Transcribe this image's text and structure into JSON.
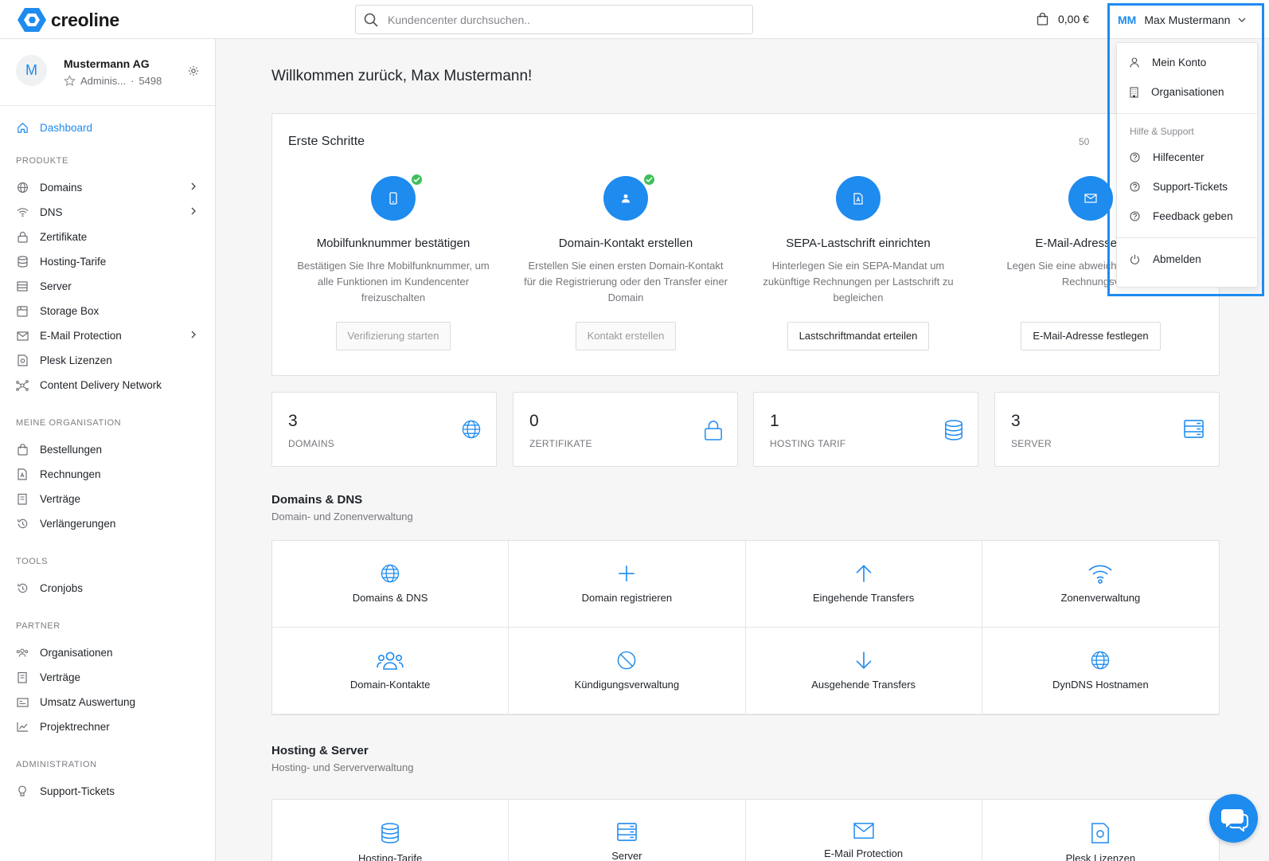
{
  "brand": {
    "name": "creoline",
    "color": "#1e8bef"
  },
  "search": {
    "placeholder": "Kundencenter durchsuchen.."
  },
  "cart": {
    "amount": "0,00 €"
  },
  "user": {
    "initials": "MM",
    "name": "Max Mustermann"
  },
  "org": {
    "avatar": "M",
    "name": "Mustermann AG",
    "role": "Adminis...",
    "separator": "·",
    "number": "5498"
  },
  "sidebar": {
    "dashboard": "Dashboard",
    "sections": [
      {
        "title": "PRODUKTE",
        "items": [
          "Domains",
          "DNS",
          "Zertifikate",
          "Hosting-Tarife",
          "Server",
          "Storage Box",
          "E-Mail Protection",
          "Plesk Lizenzen",
          "Content Delivery Network"
        ]
      },
      {
        "title": "MEINE ORGANISATION",
        "items": [
          "Bestellungen",
          "Rechnungen",
          "Verträge",
          "Verlängerungen"
        ]
      },
      {
        "title": "TOOLS",
        "items": [
          "Cronjobs"
        ]
      },
      {
        "title": "PARTNER",
        "items": [
          "Organisationen",
          "Verträge",
          "Umsatz Auswertung",
          "Projektrechner"
        ]
      },
      {
        "title": "ADMINISTRATION",
        "items": [
          "Support-Tickets"
        ]
      }
    ]
  },
  "main": {
    "welcome": "Willkommen zurück, Max Mustermann!",
    "steps": {
      "title": "Erste Schritte",
      "progress": "50",
      "items": [
        {
          "title": "Mobilfunknummer bestätigen",
          "desc": "Bestätigen Sie Ihre Mobilfunknummer, um alle Funktionen im Kundencenter freizuschalten",
          "button": "Verifizierung starten",
          "done": true,
          "icon": "phone-icon"
        },
        {
          "title": "Domain-Kontakt erstellen",
          "desc": "Erstellen Sie einen ersten Domain-Kontakt für die Registrierung oder den Transfer einer Domain",
          "button": "Kontakt erstellen",
          "done": true,
          "icon": "user-icon"
        },
        {
          "title": "SEPA-Lastschrift einrichten",
          "desc": "Hinterlegen Sie ein SEPA-Mandat um zukünftige Rechnungen per Lastschrift zu begleichen",
          "button": "Lastschriftmandat erteilen",
          "done": false,
          "icon": "pdf-icon"
        },
        {
          "title": "E-Mail-Adresse für R",
          "desc": "Legen Sie eine abweichende für den Rechnungsv",
          "button": "E-Mail-Adresse festlegen",
          "done": false,
          "icon": "mail-icon"
        }
      ]
    },
    "stats": [
      {
        "value": "3",
        "label": "DOMAINS",
        "icon": "globe-icon"
      },
      {
        "value": "0",
        "label": "ZERTIFIKATE",
        "icon": "lock-icon"
      },
      {
        "value": "1",
        "label": "HOSTING TARIF",
        "icon": "database-icon"
      },
      {
        "value": "3",
        "label": "SERVER",
        "icon": "server-icon"
      }
    ],
    "domains_section": {
      "title": "Domains & DNS",
      "subtitle": "Domain- und Zonenverwaltung",
      "tiles": [
        "Domains & DNS",
        "Domain registrieren",
        "Eingehende Transfers",
        "Zonenverwaltung",
        "Domain-Kontakte",
        "Kündigungsverwaltung",
        "Ausgehende Transfers",
        "DynDNS Hostnamen"
      ]
    },
    "hosting_section": {
      "title": "Hosting & Server",
      "subtitle": "Hosting- und Serververwaltung",
      "tiles": [
        "Hosting-Tarife",
        "Server",
        "E-Mail Protection",
        "Plesk Lizenzen"
      ]
    }
  },
  "dropdown": {
    "items": [
      "Mein Konto",
      "Organisationen"
    ],
    "help_title": "Hilfe & Support",
    "help_items": [
      "Hilfecenter",
      "Support-Tickets",
      "Feedback geben"
    ],
    "logout": "Abmelden"
  }
}
